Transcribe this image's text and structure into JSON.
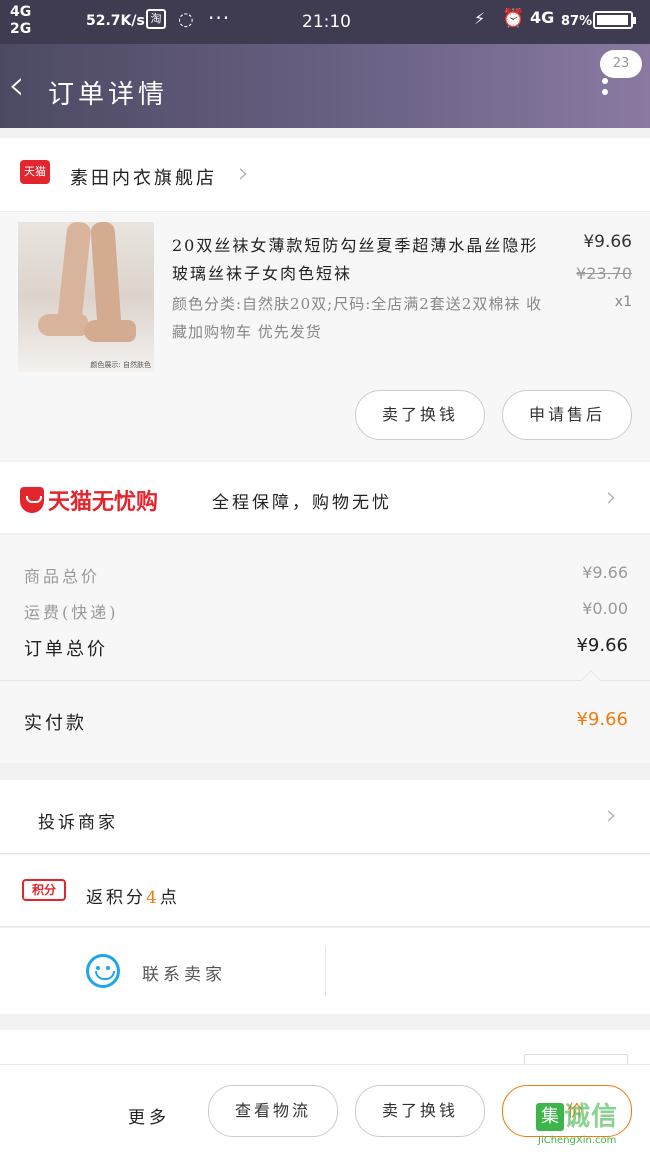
{
  "status_bar": {
    "net_top": "4G",
    "net_bottom": "2G",
    "speed": "52.7K/s",
    "app_icon": "淘",
    "time": "21:10",
    "network": "4G",
    "battery": "87%"
  },
  "header": {
    "title": "订单详情",
    "badge": "23"
  },
  "shop": {
    "logo": "天猫",
    "name": "素田内衣旗舰店"
  },
  "product": {
    "title": "20双丝袜女薄款短防勾丝夏季超薄水晶丝隐形玻璃丝袜子女肉色短袜",
    "spec": "颜色分类:自然肤20双;尺码:全店满2套送2双棉袜 收藏加购物车 优先发货",
    "price": "¥9.66",
    "old_price": "¥23.70",
    "quantity": "x1",
    "thumb_caption": "颜色展示: 自然肤色",
    "btn_return": "卖了换钱",
    "btn_after_sale": "申请售后"
  },
  "guarantee": {
    "logo": "天猫无忧购",
    "slogan": "全程保障，购物无忧"
  },
  "totals": {
    "goods_label": "商品总价",
    "goods_value": "¥9.66",
    "shipping_label": "运费(快递)",
    "shipping_value": "¥0.00",
    "order_label": "订单总价",
    "order_value": "¥9.66",
    "paid_label": "实付款",
    "paid_value": "¥9.66"
  },
  "actions": {
    "complain": "投诉商家",
    "points_tag": "积分",
    "points_text": "返积分",
    "points_value": "4",
    "points_unit": "点",
    "contact": "联系卖家"
  },
  "bottom_bar": {
    "more": "更多",
    "logistics": "查看物流",
    "sell": "卖了换钱",
    "review": "评价"
  },
  "watermark": {
    "mark": "集",
    "cn": "诚信",
    "en": "JiChengXin.com"
  },
  "colors": {
    "header_start": "#4c4a63",
    "header_end": "#8a7aa2",
    "tmall_red": "#e3262e",
    "accent_orange": "#f07b0e",
    "contact_blue": "#1ea7e8"
  }
}
